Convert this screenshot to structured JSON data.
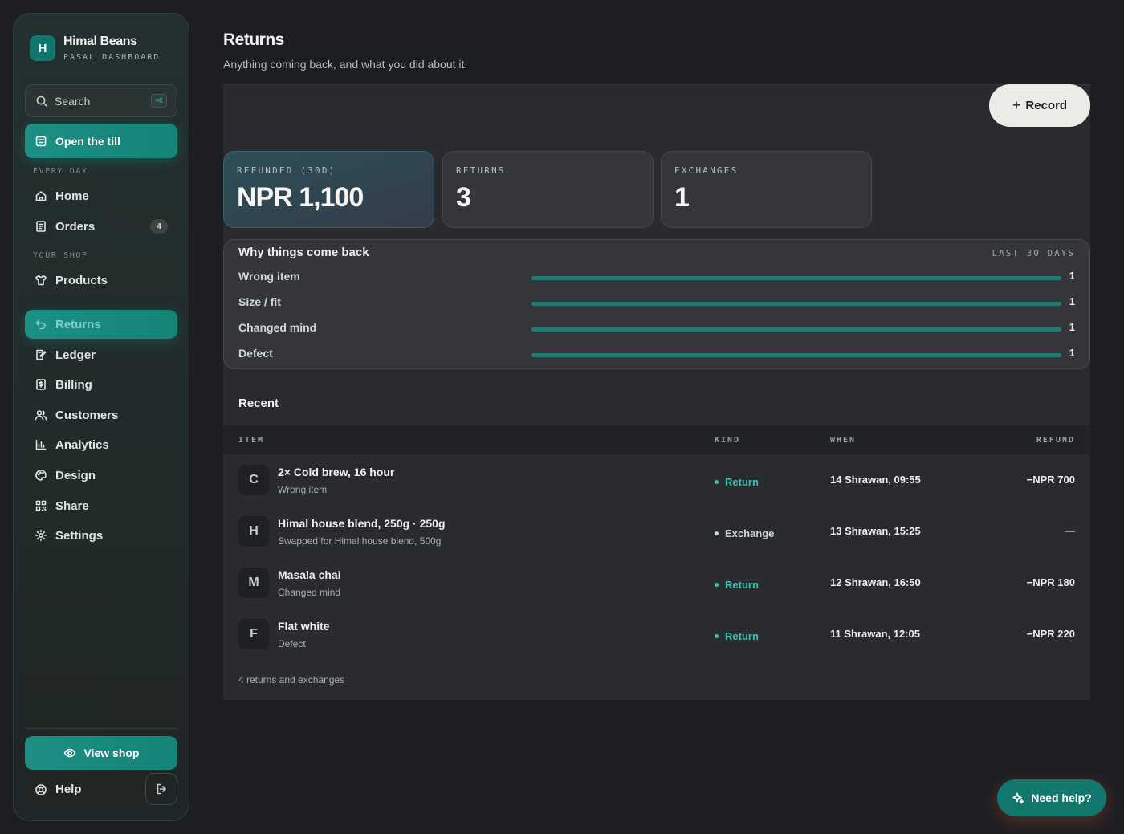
{
  "brand": {
    "initial": "H",
    "name": "Himal Beans",
    "subtitle": "PASAL DASHBOARD"
  },
  "search": {
    "label": "Search",
    "shortcut": "⌘K"
  },
  "sidebar": {
    "primary_action": "Open the till",
    "sections": [
      {
        "label": "EVERY DAY"
      },
      {
        "label": "YOUR SHOP"
      }
    ],
    "items": [
      {
        "label": "Home",
        "icon": "home-icon"
      },
      {
        "label": "Orders",
        "icon": "receipt-icon",
        "badge": "4"
      },
      {
        "label": "Products",
        "icon": "shirt-icon"
      },
      {
        "label": "Returns",
        "icon": "undo-icon",
        "active": true
      },
      {
        "label": "Ledger",
        "icon": "ledger-icon"
      },
      {
        "label": "Billing",
        "icon": "billing-icon"
      },
      {
        "label": "Customers",
        "icon": "users-icon"
      },
      {
        "label": "Analytics",
        "icon": "chart-icon"
      },
      {
        "label": "Design",
        "icon": "palette-icon"
      },
      {
        "label": "Share",
        "icon": "qr-icon"
      },
      {
        "label": "Settings",
        "icon": "gear-icon"
      }
    ],
    "view_shop": "View shop",
    "help": "Help"
  },
  "page": {
    "title": "Returns",
    "subtitle": "Anything coming back, and what you did about it.",
    "record_label": "Record"
  },
  "stats": [
    {
      "label": "REFUNDED (30D)",
      "value": "NPR 1,100"
    },
    {
      "label": "RETURNS",
      "value": "3"
    },
    {
      "label": "EXCHANGES",
      "value": "1"
    }
  ],
  "reasons": {
    "title": "Why things come back",
    "period": "LAST 30 DAYS",
    "items": [
      {
        "label": "Wrong item",
        "count": "1",
        "fraction": 1
      },
      {
        "label": "Size / fit",
        "count": "1",
        "fraction": 1
      },
      {
        "label": "Changed mind",
        "count": "1",
        "fraction": 1
      },
      {
        "label": "Defect",
        "count": "1",
        "fraction": 1
      }
    ]
  },
  "recent": {
    "title": "Recent",
    "columns": {
      "item": "ITEM",
      "kind": "KIND",
      "when": "WHEN",
      "refund": "REFUND"
    },
    "rows": [
      {
        "initial": "C",
        "name": "2× Cold brew, 16 hour",
        "note": "Wrong item",
        "kind": "Return",
        "when": "14 Shrawan, 09:55",
        "refund": "−NPR 700"
      },
      {
        "initial": "H",
        "name": "Himal house blend, 250g · 250g",
        "note": "Swapped for Himal house blend, 500g",
        "kind": "Exchange",
        "when": "13 Shrawan, 15:25",
        "refund": "—"
      },
      {
        "initial": "M",
        "name": "Masala chai",
        "note": "Changed mind",
        "kind": "Return",
        "when": "12 Shrawan, 16:50",
        "refund": "−NPR 180"
      },
      {
        "initial": "F",
        "name": "Flat white",
        "note": "Defect",
        "kind": "Return",
        "when": "11 Shrawan, 12:05",
        "refund": "−NPR 220"
      }
    ],
    "footnote": "4 returns and exchanges"
  },
  "need_help": "Need help?",
  "colors": {
    "accent": "#158478",
    "return": "#3fbfae",
    "background": "#1d1e22"
  }
}
